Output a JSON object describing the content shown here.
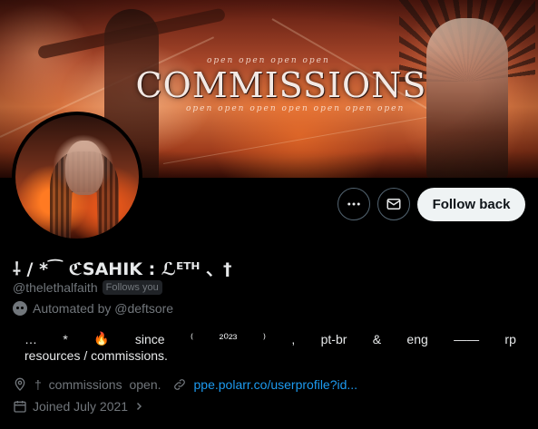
{
  "banner": {
    "title": "COMMISSIONS",
    "script_top": "open open open open",
    "script_bottom": "open open open open open open open"
  },
  "actions": {
    "more_icon": "more-horizontal-icon",
    "message_icon": "envelope-icon",
    "follow_back_label": "Follow back"
  },
  "profile": {
    "display_name": "⸸ / *⁀ ℭSAHIK : ℒᴱᵀᴴ 、†",
    "handle": "@thelethalfaith",
    "follows_you": "Follows you",
    "automated_by": "Automated by @deftsore",
    "bio": {
      "line1_tokens": [
        "…",
        "*",
        "🔥",
        "since",
        "⁽",
        "²⁰²³",
        "⁾",
        ",",
        "pt-br",
        "&",
        "eng",
        "——",
        "rp"
      ],
      "line2": "resources / commissions."
    },
    "location": "† commissions open.",
    "website": "ppe.polarr.co/userprofile?id...",
    "joined": "Joined July 2021"
  },
  "colors": {
    "background": "#000000",
    "text_primary": "#e7e9ea",
    "text_secondary": "#71767b",
    "link": "#1d9bf0",
    "follow_button_bg": "#eff3f4"
  }
}
